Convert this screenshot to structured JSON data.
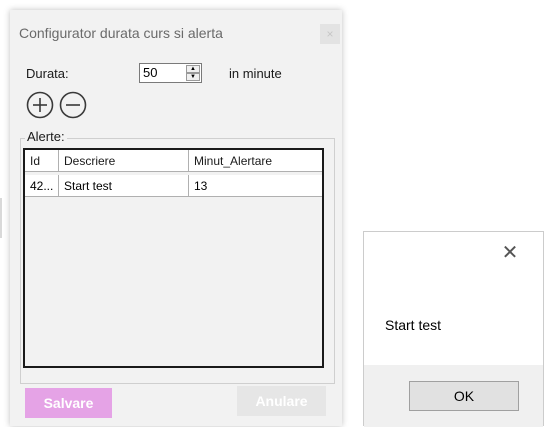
{
  "configurator": {
    "title": "Configurator durata curs si alerta",
    "close_label": "×",
    "duration_label": "Durata:",
    "duration_value": "50",
    "duration_unit": "in minute",
    "add_icon": "plus-circle-icon",
    "remove_icon": "minus-circle-icon",
    "alerts_label": "Alerte:",
    "columns": [
      "Id",
      "Descriere",
      "Minut_Alertare"
    ],
    "rows": [
      [
        "42...",
        "Start test",
        "13"
      ]
    ],
    "save_label": "Salvare",
    "cancel_label": "Anulare",
    "colors": {
      "save": "#e5a3e6",
      "cancel": "#e6e6e6"
    }
  },
  "message_box": {
    "close_label": "✕",
    "message": "Start test",
    "ok_label": "OK"
  }
}
